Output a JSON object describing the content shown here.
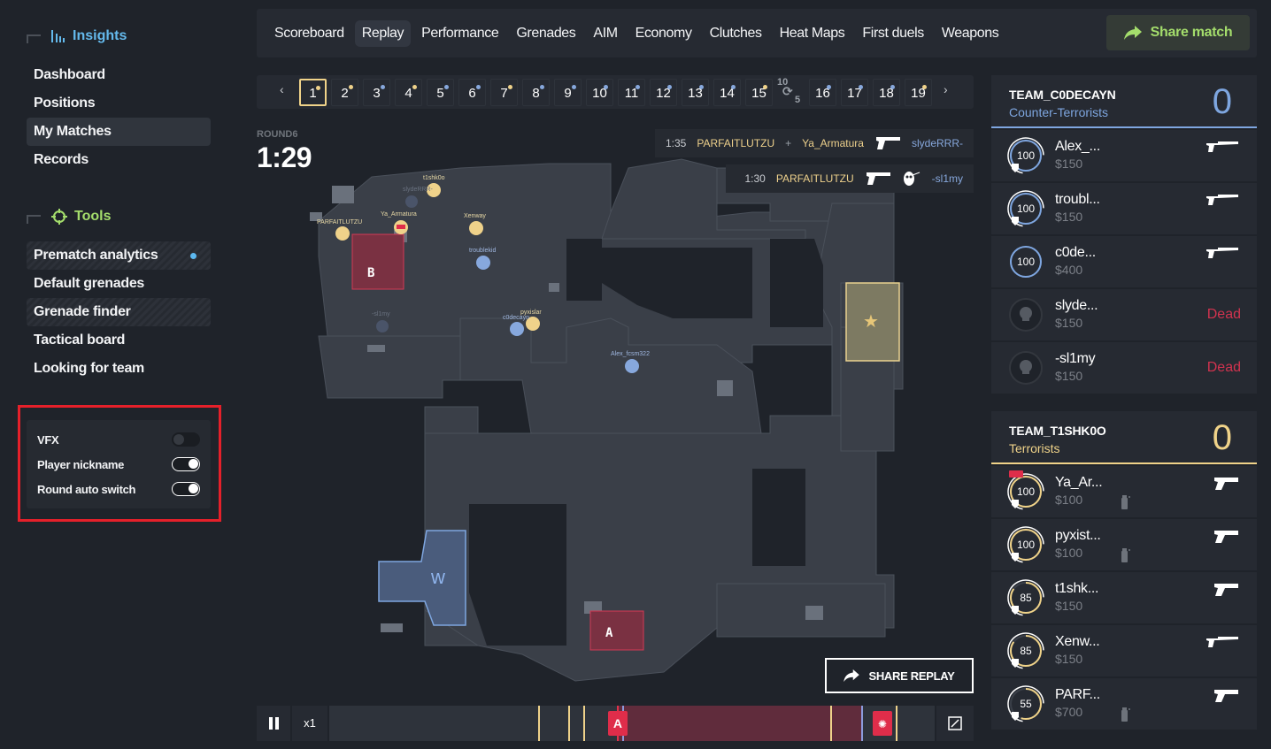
{
  "sidebar": {
    "insights": {
      "title": "Insights",
      "icon": "bar-chart-icon",
      "items": [
        {
          "label": "Dashboard"
        },
        {
          "label": "Positions"
        },
        {
          "label": "My Matches",
          "active": true
        },
        {
          "label": "Records"
        }
      ]
    },
    "tools": {
      "title": "Tools",
      "icon": "crosshair-icon",
      "items": [
        {
          "label": "Prematch analytics",
          "striped": true,
          "new_dot": true
        },
        {
          "label": "Default grenades"
        },
        {
          "label": "Grenade finder",
          "striped": true
        },
        {
          "label": "Tactical board"
        },
        {
          "label": "Looking for team"
        }
      ]
    },
    "settings": [
      {
        "label": "VFX",
        "enabled": false
      },
      {
        "label": "Player nickname",
        "enabled": true
      },
      {
        "label": "Round auto switch",
        "enabled": true
      }
    ]
  },
  "topnav": {
    "tabs": [
      {
        "label": "Scoreboard"
      },
      {
        "label": "Replay",
        "active": true
      },
      {
        "label": "Performance"
      },
      {
        "label": "Grenades"
      },
      {
        "label": "AIM"
      },
      {
        "label": "Economy"
      },
      {
        "label": "Clutches"
      },
      {
        "label": "Heat Maps"
      },
      {
        "label": "First duels"
      },
      {
        "label": "Weapons"
      }
    ],
    "share_match": "Share match"
  },
  "rounds": {
    "prev": "‹",
    "next": "›",
    "selected": 1,
    "items": [
      {
        "n": "1",
        "winner": "t"
      },
      {
        "n": "2",
        "winner": "t"
      },
      {
        "n": "3",
        "winner": "ct"
      },
      {
        "n": "4",
        "winner": "t"
      },
      {
        "n": "5",
        "winner": "ct"
      },
      {
        "n": "6",
        "winner": "ct"
      },
      {
        "n": "7",
        "winner": "t"
      },
      {
        "n": "8",
        "winner": "ct"
      },
      {
        "n": "9",
        "winner": "ct"
      },
      {
        "n": "10",
        "winner": "ct"
      },
      {
        "n": "11",
        "winner": "ct"
      },
      {
        "n": "12",
        "winner": "ct"
      },
      {
        "n": "13",
        "winner": "ct"
      },
      {
        "n": "14",
        "winner": "ct"
      },
      {
        "n": "15",
        "winner": "t"
      },
      {
        "n": "16",
        "winner": "ct"
      },
      {
        "n": "17",
        "winner": "ct"
      },
      {
        "n": "18",
        "winner": "ct"
      },
      {
        "n": "19",
        "winner": "t"
      }
    ],
    "halftime": {
      "top": "10",
      "bottom": "5"
    }
  },
  "replay": {
    "round_label": "ROUND6",
    "timer": "1:29"
  },
  "killfeed": [
    {
      "time": "1:35",
      "killer": "PARFAITLUTZU",
      "assist": "Ya_Armatura",
      "plus": "+",
      "victim": "slydeRRR-",
      "weapon": "pistol-icon"
    },
    {
      "time": "1:30",
      "killer": "PARFAITLUTZU",
      "victim": "-sl1my",
      "weapon": "pistol-icon",
      "headshot": true
    }
  ],
  "map": {
    "sites": {
      "a": "A",
      "b": "B"
    },
    "players": [
      {
        "name": "t1shk0o",
        "side": "t"
      },
      {
        "name": "slydeRRR-",
        "side": "ct",
        "dead": true
      },
      {
        "name": "PARFAITLUTZU",
        "side": "t"
      },
      {
        "name": "Ya_Armatura",
        "side": "t",
        "bomb": true
      },
      {
        "name": "Xenway",
        "side": "t"
      },
      {
        "name": "troublekid",
        "side": "ct"
      },
      {
        "name": "-sl1my",
        "side": "ct",
        "dead": true
      },
      {
        "name": "pyxislar",
        "side": "t"
      },
      {
        "name": "c0decayn",
        "side": "ct"
      },
      {
        "name": "Alex_fcsm322",
        "side": "ct"
      }
    ]
  },
  "share_replay": "SHARE REPLAY",
  "playback": {
    "speed": "x1",
    "progress_start": 0.475,
    "progress_end": 0.88,
    "bomb_plant_label": "A",
    "markers": [
      {
        "pos": 0.345,
        "type": "y"
      },
      {
        "pos": 0.395,
        "type": "y"
      },
      {
        "pos": 0.42,
        "type": "y"
      },
      {
        "pos": 0.484,
        "type": "b"
      },
      {
        "pos": 0.828,
        "type": "y"
      },
      {
        "pos": 0.878,
        "type": "b"
      },
      {
        "pos": 0.935,
        "type": "y"
      }
    ]
  },
  "teams": {
    "ct": {
      "name": "TEAM_C0DECAYN",
      "side": "Counter-Terrorists",
      "score": "0",
      "players": [
        {
          "name": "Alex_...",
          "money": "$150",
          "hp": "100",
          "armor": true,
          "weapon": "usp-icon"
        },
        {
          "name": "troubl...",
          "money": "$150",
          "hp": "100",
          "armor": true,
          "weapon": "usp-icon"
        },
        {
          "name": "c0de...",
          "money": "$400",
          "hp": "100",
          "armor": false,
          "weapon": "usp-icon"
        },
        {
          "name": "slyde...",
          "money": "$150",
          "dead": true,
          "status": "Dead"
        },
        {
          "name": "-sl1my",
          "money": "$150",
          "dead": true,
          "status": "Dead"
        }
      ]
    },
    "t": {
      "name": "TEAM_T1SHK0O",
      "side": "Terrorists",
      "score": "0",
      "players": [
        {
          "name": "Ya_Ar...",
          "money": "$100",
          "hp": "100",
          "armor": true,
          "weapon": "glock-icon",
          "bomb": true,
          "grenade": true
        },
        {
          "name": "pyxist...",
          "money": "$100",
          "hp": "100",
          "armor": true,
          "weapon": "glock-icon",
          "grenade": true
        },
        {
          "name": "t1shk...",
          "money": "$150",
          "hp": "85",
          "armor": true,
          "weapon": "glock-icon"
        },
        {
          "name": "Xenw...",
          "money": "$150",
          "hp": "85",
          "armor": true,
          "weapon": "usp-icon"
        },
        {
          "name": "PARF...",
          "money": "$700",
          "hp": "55",
          "armor": true,
          "weapon": "glock-icon",
          "grenade": true
        }
      ]
    }
  }
}
